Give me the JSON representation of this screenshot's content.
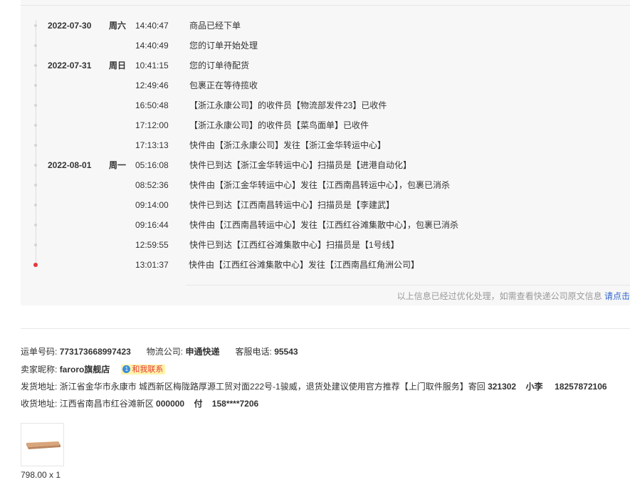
{
  "tracking": {
    "rows": [
      {
        "date": "2022-07-30",
        "weekday": "周六",
        "time": "14:40:47",
        "desc": "商品已经下单"
      },
      {
        "date": "",
        "weekday": "",
        "time": "14:40:49",
        "desc": "您的订单开始处理"
      },
      {
        "date": "2022-07-31",
        "weekday": "周日",
        "time": "10:41:15",
        "desc": "您的订单待配货"
      },
      {
        "date": "",
        "weekday": "",
        "time": "12:49:46",
        "desc": "包裹正在等待揽收"
      },
      {
        "date": "",
        "weekday": "",
        "time": "16:50:48",
        "desc": "【浙江永康公司】的收件员【物流部发件23】已收件"
      },
      {
        "date": "",
        "weekday": "",
        "time": "17:12:00",
        "desc": "【浙江永康公司】的收件员【菜鸟面单】已收件"
      },
      {
        "date": "",
        "weekday": "",
        "time": "17:13:13",
        "desc": "快件由【浙江永康公司】发往【浙江金华转运中心】"
      },
      {
        "date": "2022-08-01",
        "weekday": "周一",
        "time": "05:16:08",
        "desc": "快件已到达【浙江金华转运中心】扫描员是【进港自动化】"
      },
      {
        "date": "",
        "weekday": "",
        "time": "08:52:36",
        "desc": "快件由【浙江金华转运中心】发往【江西南昌转运中心】，包裹已消杀"
      },
      {
        "date": "",
        "weekday": "",
        "time": "09:14:00",
        "desc": "快件已到达【江西南昌转运中心】扫描员是【李建武】"
      },
      {
        "date": "",
        "weekday": "",
        "time": "09:16:44",
        "desc": "快件由【江西南昌转运中心】发往【江西红谷滩集散中心】，包裹已消杀"
      },
      {
        "date": "",
        "weekday": "",
        "time": "12:59:55",
        "desc": "快件已到达【江西红谷滩集散中心】扫描员是【1号线】"
      },
      {
        "date": "",
        "weekday": "",
        "time": "13:01:37",
        "desc": "快件由【江西红谷滩集散中心】发往【江西南昌红角洲公司】"
      }
    ],
    "notice": "以上信息已经过优化处理，如需查看快递公司原文信息",
    "notice_link": "请点击"
  },
  "shipment": {
    "tracking_no_label": "运单号码:",
    "tracking_no": "773173668997423",
    "carrier_label": "物流公司:",
    "carrier": "申通快递",
    "phone_label": "客服电话:",
    "phone": "95543",
    "seller_label": "卖家昵称:",
    "seller": "faroro旗舰店",
    "contact_badge": "1",
    "contact_label": "和我联系",
    "from_label": "发货地址:",
    "from_address": "浙江省金华市永康市 城西新区梅陇路厚源工贸对面222号-1骏威，退货处建议使用官方推荐【上门取件服务】寄回",
    "from_postcode": "321302",
    "from_name": "小李",
    "from_phone": "18257872106",
    "to_label": "收货地址:",
    "to_address": "江西省南昌市红谷滩新区",
    "to_postcode": "000000",
    "to_name": "付",
    "to_phone": "158****7206"
  },
  "product": {
    "price_qty": "798.00 x 1"
  },
  "colors": {
    "latest_dot": "#e4393c",
    "link": "#3366cc",
    "panel_bg": "#f7f7f7"
  }
}
